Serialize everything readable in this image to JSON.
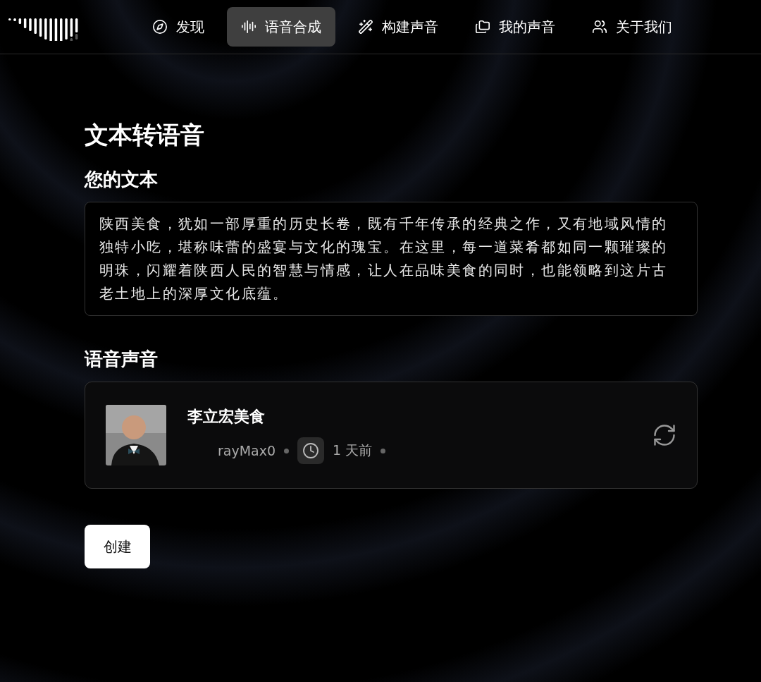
{
  "nav": {
    "items": [
      {
        "label": "发现",
        "kind": "compass",
        "selected": false
      },
      {
        "label": "语音合成",
        "kind": "audio",
        "selected": true
      },
      {
        "label": "构建声音",
        "kind": "wand",
        "selected": false
      },
      {
        "label": "我的声音",
        "kind": "folders",
        "selected": false
      },
      {
        "label": "关于我们",
        "kind": "users",
        "selected": false
      }
    ]
  },
  "page": {
    "title": "文本转语音",
    "text_label": "您的文本",
    "text_value": "陕西美食，犹如一部厚重的历史长卷，既有千年传承的经典之作，又有地域风情的独特小吃，堪称味蕾的盛宴与文化的瑰宝。在这里，每一道菜肴都如同一颗璀璨的明珠，闪耀着陕西人民的智慧与情感，让人在品味美食的同时，也能领略到这片古老土地上的深厚文化底蕴。",
    "voice_label": "语音声音",
    "voice": {
      "name": "李立宏美食",
      "author": "rayMax0",
      "time": "1 天前"
    },
    "create_button": "创建"
  }
}
